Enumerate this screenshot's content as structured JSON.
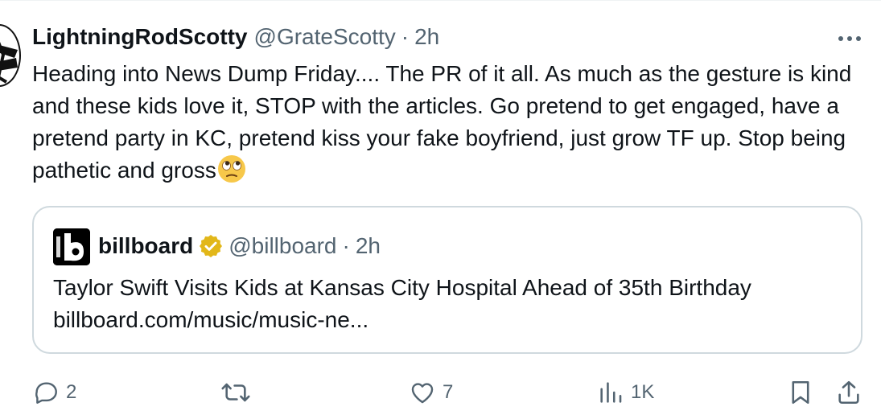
{
  "tweet": {
    "display_name": "LightningRodScotty",
    "handle": "@GrateScotty",
    "separator": "·",
    "time": "2h",
    "text": "Heading into News Dump Friday.... The PR of it all. As much as the gesture is kind and these kids love it, STOP with the articles. Go pretend to get engaged, have a pretend party in KC, pretend kiss your fake boyfriend, just grow TF up. Stop being pathetic and gross",
    "emoji": "face-with-rolling-eyes"
  },
  "quote": {
    "display_name": "billboard",
    "handle": "@billboard",
    "separator": "·",
    "time": "2h",
    "verified": true,
    "title": "Taylor Swift Visits Kids at Kansas City Hospital Ahead of 35th Birthday",
    "link": "billboard.com/music/music-ne..."
  },
  "actions": {
    "replies": "2",
    "reposts": "",
    "likes": "7",
    "views": "1K"
  },
  "colors": {
    "text_primary": "#0f1419",
    "text_secondary": "#536471",
    "border": "#cfd9de",
    "verified_gold": "#e2b719"
  }
}
